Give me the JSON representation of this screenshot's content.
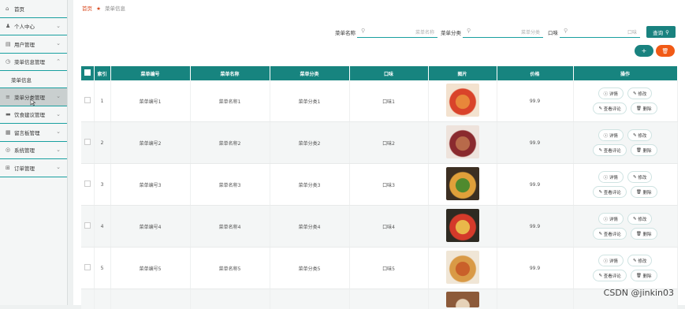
{
  "sidebar": {
    "items": [
      {
        "icon": "home-icon",
        "glyph": "⌂",
        "label": "首页",
        "chevron": ""
      },
      {
        "icon": "person-icon",
        "glyph": "♟",
        "label": "个人中心",
        "chevron": "⌄"
      },
      {
        "icon": "user-list-icon",
        "glyph": "▤",
        "label": "用户管理",
        "chevron": "⌄"
      },
      {
        "icon": "clock-icon",
        "glyph": "◷",
        "label": "菜单信息管理",
        "chevron": "⌃",
        "sub": "菜单信息"
      },
      {
        "icon": "bars-icon",
        "glyph": "≡",
        "label": "菜单分类管理",
        "chevron": "⌄"
      },
      {
        "icon": "card-icon",
        "glyph": "▬",
        "label": "饮食建议管理",
        "chevron": "⌄"
      },
      {
        "icon": "calendar-icon",
        "glyph": "▦",
        "label": "留言板管理",
        "chevron": "⌄"
      },
      {
        "icon": "settings-icon",
        "glyph": "◎",
        "label": "系统管理",
        "chevron": "⌄"
      },
      {
        "icon": "grid-icon",
        "glyph": "⊞",
        "label": "订单管理",
        "chevron": "⌄"
      }
    ]
  },
  "breadcrumb": {
    "home": "首页",
    "current": "菜单信息"
  },
  "search": {
    "name_label": "菜单名称",
    "name_placeholder": "菜单名称",
    "category_label": "菜单分类",
    "category_placeholder": "菜单分类",
    "taste_label": "口味",
    "taste_placeholder": "口味",
    "query_label": "查询"
  },
  "actions": {
    "add": "+",
    "delete": "🗑"
  },
  "table": {
    "headers": [
      "索引",
      "菜单编号",
      "菜单名称",
      "菜单分类",
      "口味",
      "图片",
      "价格",
      "操作"
    ],
    "rows": [
      {
        "index": "1",
        "code": "菜单编号1",
        "name": "菜单名称1",
        "category": "菜单分类1",
        "taste": "口味1",
        "price": "99.9"
      },
      {
        "index": "2",
        "code": "菜单编号2",
        "name": "菜单名称2",
        "category": "菜单分类2",
        "taste": "口味2",
        "price": "99.9"
      },
      {
        "index": "3",
        "code": "菜单编号3",
        "name": "菜单名称3",
        "category": "菜单分类3",
        "taste": "口味3",
        "price": "99.9"
      },
      {
        "index": "4",
        "code": "菜单编号4",
        "name": "菜单名称4",
        "category": "菜单分类4",
        "taste": "口味4",
        "price": "99.9"
      },
      {
        "index": "5",
        "code": "菜单编号5",
        "name": "菜单名称5",
        "category": "菜单分类5",
        "taste": "口味5",
        "price": "99.9"
      }
    ],
    "ops": {
      "detail": "详情",
      "edit": "修改",
      "review": "查看评论",
      "delete": "删除"
    }
  },
  "watermark": "CSDN @jinkin03",
  "colors": {
    "accent": "#17847f",
    "danger": "#f15a16",
    "breadcrumb": "#d94a1f"
  }
}
